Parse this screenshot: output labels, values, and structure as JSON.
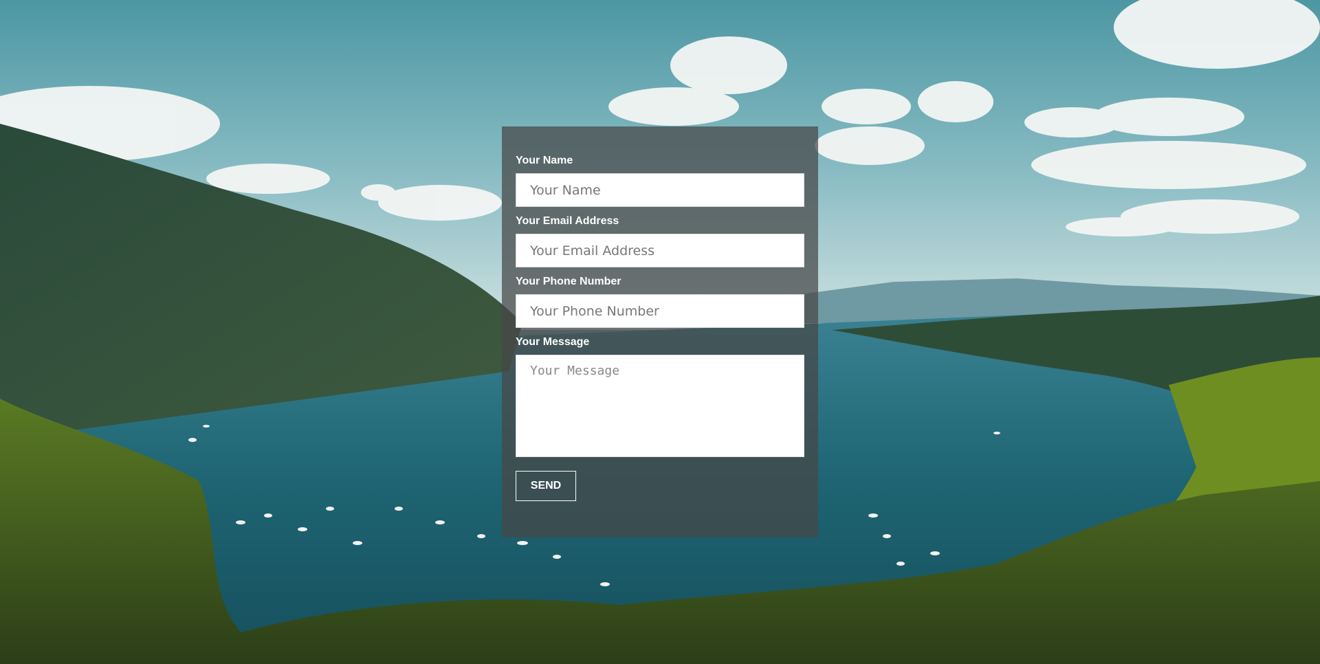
{
  "form": {
    "name": {
      "label": "Your Name",
      "placeholder": "Your Name",
      "value": ""
    },
    "email": {
      "label": "Your Email Address",
      "placeholder": "Your Email Address",
      "value": ""
    },
    "phone": {
      "label": "Your Phone Number",
      "placeholder": "Your Phone Number",
      "value": ""
    },
    "message": {
      "label": "Your Message",
      "placeholder": "Your Message",
      "value": ""
    },
    "send_label": "SEND"
  },
  "background": {
    "scene": "lake-landscape-image"
  },
  "colors": {
    "panel": "#464646",
    "sky": "#6eaab3",
    "water": "#1f5f6c",
    "forest": "#2f4a2a"
  }
}
